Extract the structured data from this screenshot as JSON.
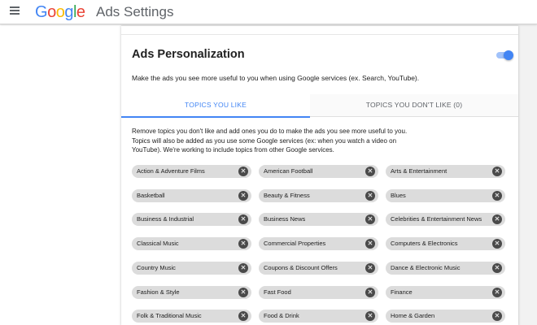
{
  "header": {
    "menu_icon": "menu-icon",
    "logo_text": "Google",
    "logo_colors": [
      "#4285f4",
      "#ea4335",
      "#fbbc05",
      "#4285f4",
      "#34a853",
      "#ea4335"
    ],
    "title": "Ads Settings"
  },
  "card": {
    "title": "Ads Personalization",
    "toggle_on": true,
    "description": "Make the ads you see more useful to you when using Google services (ex. Search, YouTube).",
    "tabs": [
      {
        "label": "TOPICS YOU LIKE",
        "active": true
      },
      {
        "label": "TOPICS YOU DON'T LIKE (0)",
        "active": false
      }
    ],
    "intro": "Remove topics you don't like and add ones you do to make the ads you see more useful to you. Topics will also be added as you use some Google services (ex: when you watch a video on YouTube). We're working to include topics from other Google services.",
    "topics": [
      "Action & Adventure Films",
      "American Football",
      "Arts & Entertainment",
      "Basketball",
      "Beauty & Fitness",
      "Blues",
      "Business & Industrial",
      "Business News",
      "Celebrities & Entertainment News",
      "Classical Music",
      "Commercial Properties",
      "Computers & Electronics",
      "Country Music",
      "Coupons & Discount Offers",
      "Dance & Electronic Music",
      "Fashion & Style",
      "Fast Food",
      "Finance",
      "Folk & Traditional Music",
      "Food & Drink",
      "Home & Garden"
    ],
    "remove_icon": "close-circle-icon"
  },
  "colors": {
    "accent": "#4285f4",
    "chip_bg": "#dcdcdc"
  }
}
